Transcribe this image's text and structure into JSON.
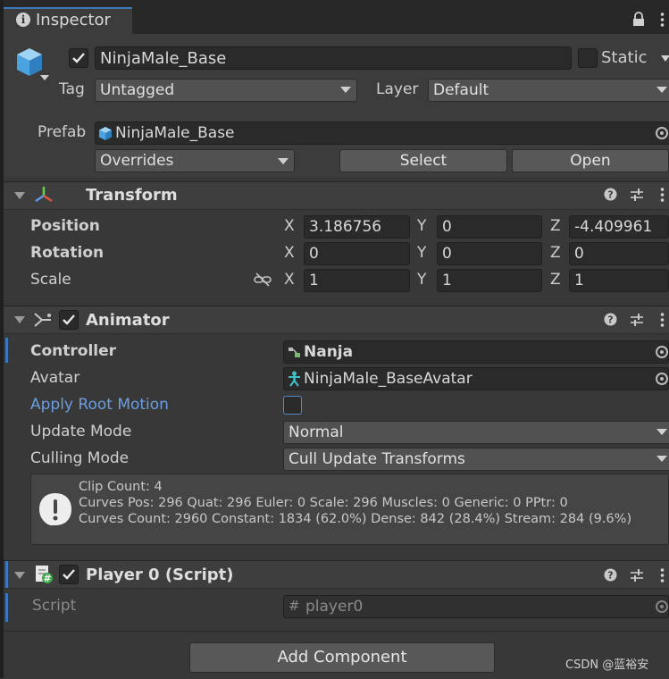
{
  "window": {
    "tab_title": "Inspector"
  },
  "gameobject": {
    "name": "NinjaMale_Base",
    "static_label": "Static",
    "tag_label": "Tag",
    "tag_value": "Untagged",
    "layer_label": "Layer",
    "layer_value": "Default",
    "prefab_label": "Prefab",
    "prefab_value": "NinjaMale_Base",
    "overrides_label": "Overrides",
    "select_label": "Select",
    "open_label": "Open",
    "active": true
  },
  "transform": {
    "title": "Transform",
    "rows": [
      {
        "label": "Position",
        "x": "3.186756",
        "y": "0",
        "z": "-4.409961"
      },
      {
        "label": "Rotation",
        "x": "0",
        "y": "0",
        "z": "0"
      },
      {
        "label": "Scale",
        "x": "1",
        "y": "1",
        "z": "1"
      }
    ],
    "axis": {
      "x": "X",
      "y": "Y",
      "z": "Z"
    }
  },
  "animator": {
    "title": "Animator",
    "enabled": true,
    "controller_label": "Controller",
    "controller_value": "Nanja",
    "avatar_label": "Avatar",
    "avatar_value": "NinjaMale_BaseAvatar",
    "apply_root_motion_label": "Apply Root Motion",
    "apply_root_motion": false,
    "update_mode_label": "Update Mode",
    "update_mode_value": "Normal",
    "culling_mode_label": "Culling Mode",
    "culling_mode_value": "Cull Update Transforms",
    "info_lines": [
      "Clip Count: 4",
      "Curves Pos: 296 Quat: 296 Euler: 0 Scale: 296 Muscles: 0 Generic: 0 PPtr: 0",
      "Curves Count: 2960 Constant: 1834 (62.0%) Dense: 842 (28.4%) Stream: 284 (9.6%)"
    ]
  },
  "player_script": {
    "title": "Player 0 (Script)",
    "enabled": true,
    "script_label": "Script",
    "script_value": "player0"
  },
  "footer": {
    "add_component_label": "Add Component",
    "watermark": "CSDN @蓝裕安"
  },
  "colors": {
    "background": "#383838",
    "header": "#3e3e3e",
    "field": "#2a2a2a",
    "accent_blue": "#3a79bb",
    "link_blue": "#6b9ee0"
  },
  "icons": [
    "info-icon",
    "lock-icon",
    "kebab-icon",
    "gameobject-cube-icon",
    "transform-icon",
    "animator-icon",
    "script-icon",
    "help-icon",
    "preset-icon",
    "object-picker-icon",
    "unlink-icon",
    "warning-icon",
    "checkmark-icon"
  ]
}
